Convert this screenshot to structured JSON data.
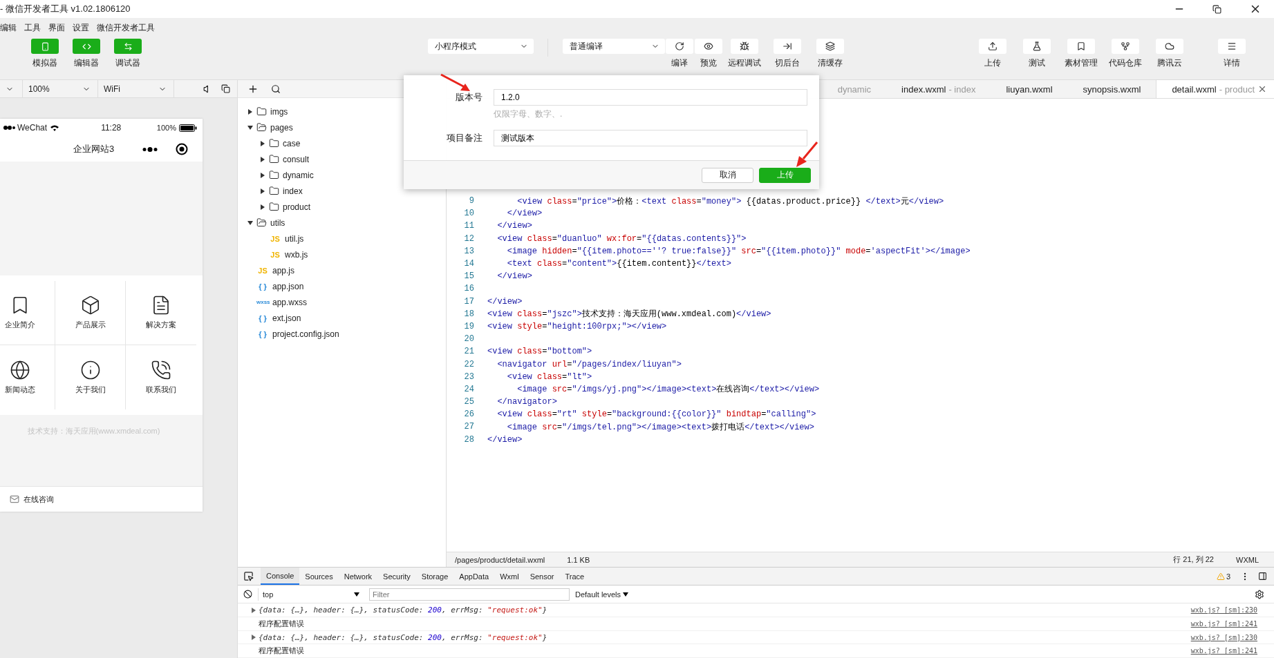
{
  "window": {
    "title": "- 微信开发者工具 v1.02.1806120"
  },
  "menu": [
    "编辑",
    "工具",
    "界面",
    "设置",
    "微信开发者工具"
  ],
  "toolbar": {
    "views": [
      {
        "label": "模拟器",
        "selected": true
      },
      {
        "label": "编辑器",
        "selected": true
      },
      {
        "label": "调试器",
        "selected": true
      }
    ],
    "mode_select": "小程序模式",
    "compile_select": "普通编译",
    "actions": [
      "编译",
      "预览",
      "远程调试",
      "切后台",
      "清缓存"
    ],
    "right_actions": [
      "上传",
      "测试",
      "素材管理",
      "代码仓库",
      "腾讯云"
    ],
    "details": "详情"
  },
  "simulator": {
    "zoom": "100%",
    "network": "WiFi",
    "status_bar": {
      "carrier": "WeChat",
      "time": "11:28",
      "battery": "100%"
    },
    "nav_title": "企业网站3",
    "grid": [
      "企业简介",
      "产品展示",
      "解决方案",
      "新闻动态",
      "关于我们",
      "联系我们"
    ],
    "footer": "技术支持：海天应用(www.xmdeal.com)",
    "bottom_link": "在线咨询"
  },
  "file_tree": [
    {
      "name": "imgs",
      "kind": "folder",
      "expanded": false
    },
    {
      "name": "pages",
      "kind": "folder",
      "expanded": true,
      "children": [
        {
          "name": "case",
          "kind": "folder",
          "expanded": false
        },
        {
          "name": "consult",
          "kind": "folder",
          "expanded": false
        },
        {
          "name": "dynamic",
          "kind": "folder",
          "expanded": false
        },
        {
          "name": "index",
          "kind": "folder",
          "expanded": false
        },
        {
          "name": "product",
          "kind": "folder",
          "expanded": false
        }
      ]
    },
    {
      "name": "utils",
      "kind": "folder",
      "expanded": true,
      "children": [
        {
          "name": "util.js",
          "kind": "js",
          "badge": "JS"
        },
        {
          "name": "wxb.js",
          "kind": "js",
          "badge": "JS"
        }
      ]
    },
    {
      "name": "app.js",
      "kind": "js",
      "badge": "JS"
    },
    {
      "name": "app.json",
      "kind": "json",
      "badge": "{ }"
    },
    {
      "name": "app.wxss",
      "kind": "wxss",
      "badge": "wxss"
    },
    {
      "name": "ext.json",
      "kind": "json",
      "badge": "{ }"
    },
    {
      "name": "project.config.json",
      "kind": "json",
      "badge": "{ }"
    }
  ],
  "editor": {
    "tabs": [
      {
        "suffix": "dynamic",
        "selected": false
      },
      {
        "name": "index.wxml",
        "suffix": "- index",
        "selected": false
      },
      {
        "name": "liuyan.wxml",
        "selected": false
      },
      {
        "name": "synopsis.wxml",
        "selected": false
      },
      {
        "name": "detail.wxml",
        "suffix": "- product",
        "selected": true
      }
    ],
    "lines": [
      {
        "number": "9",
        "text": "      <view class=\"price\">价格：<text class=\"money\"> {{datas.product.price}} </text>元</view>"
      },
      {
        "number": "10",
        "text": "    </view>"
      },
      {
        "number": "11",
        "text": "  </view>"
      },
      {
        "number": "12",
        "text": "  <view class=\"duanluo\" wx:for=\"{{datas.contents}}\">"
      },
      {
        "number": "13",
        "text": "    <image hidden=\"{{item.photo==''? true:false}}\" src=\"{{item.photo}}\" mode='aspectFit'></image>"
      },
      {
        "number": "14",
        "text": "    <text class=\"content\">{{item.content}}</text>"
      },
      {
        "number": "15",
        "text": "  </view>"
      },
      {
        "number": "16"
      },
      {
        "number": "17",
        "text": "</view>"
      },
      {
        "number": "18",
        "text": "<view class=\"jszc\">技术支持：海天应用(www.xmdeal.com)</view>"
      },
      {
        "number": "19",
        "text": "<view style=\"height:100rpx;\"></view>"
      },
      {
        "number": "20"
      },
      {
        "number": "21",
        "text": "<view class=\"bottom\">"
      },
      {
        "number": "22",
        "text": "  <navigator url=\"/pages/index/liuyan\">"
      },
      {
        "number": "23",
        "text": "    <view class=\"lt\">"
      },
      {
        "number": "24",
        "text": "      <image src=\"/imgs/yj.png\"></image><text>在线咨询</text></view>"
      },
      {
        "number": "25",
        "text": "  </navigator>"
      },
      {
        "number": "26",
        "text": "  <view class=\"rt\" style=\"background:{{color}}\" bindtap=\"calling\">"
      },
      {
        "number": "27",
        "text": "    <image src=\"/imgs/tel.png\"></image><text>拨打电话</text></view>"
      },
      {
        "number": "28",
        "text": "</view>"
      }
    ],
    "status": {
      "path": "/pages/product/detail.wxml",
      "size": "1.1 KB",
      "position": "行 21, 列 22",
      "language": "WXML"
    }
  },
  "dialog": {
    "fields": [
      {
        "label": "版本号",
        "value": "1.2.0",
        "hint": "仅限字母、数字、."
      },
      {
        "label": "项目备注",
        "value": "测试版本"
      }
    ],
    "buttons": [
      {
        "label": "取消",
        "kind": "secondary"
      },
      {
        "label": "上传",
        "kind": "primary"
      }
    ]
  },
  "devtools": {
    "tabs": [
      {
        "label": "Console",
        "selected": true
      },
      {
        "label": "Sources",
        "selected": false
      },
      {
        "label": "Network",
        "selected": false
      },
      {
        "label": "Security",
        "selected": false
      },
      {
        "label": "Storage",
        "selected": false
      },
      {
        "label": "AppData",
        "selected": false
      },
      {
        "label": "Wxml",
        "selected": false
      },
      {
        "label": "Sensor",
        "selected": false
      },
      {
        "label": "Trace",
        "selected": false
      }
    ],
    "warning_count": "3",
    "context": "top",
    "filter_placeholder": "Filter",
    "levels": "Default levels",
    "logs": [
      {
        "kind": "object",
        "text": "{data: {…}, header: {…}, statusCode: 200, errMsg: \"request:ok\"}",
        "source": "wxb.js? [sm]:230"
      },
      {
        "kind": "plain",
        "text": "程序配置错误",
        "source": "wxb.js? [sm]:241"
      },
      {
        "kind": "object",
        "text": "{data: {…}, header: {…}, statusCode: 200, errMsg: \"request:ok\"}",
        "source": "wxb.js? [sm]:230"
      },
      {
        "kind": "plain",
        "text": "程序配置错误",
        "source": "wxb.js? [sm]:241"
      }
    ]
  }
}
